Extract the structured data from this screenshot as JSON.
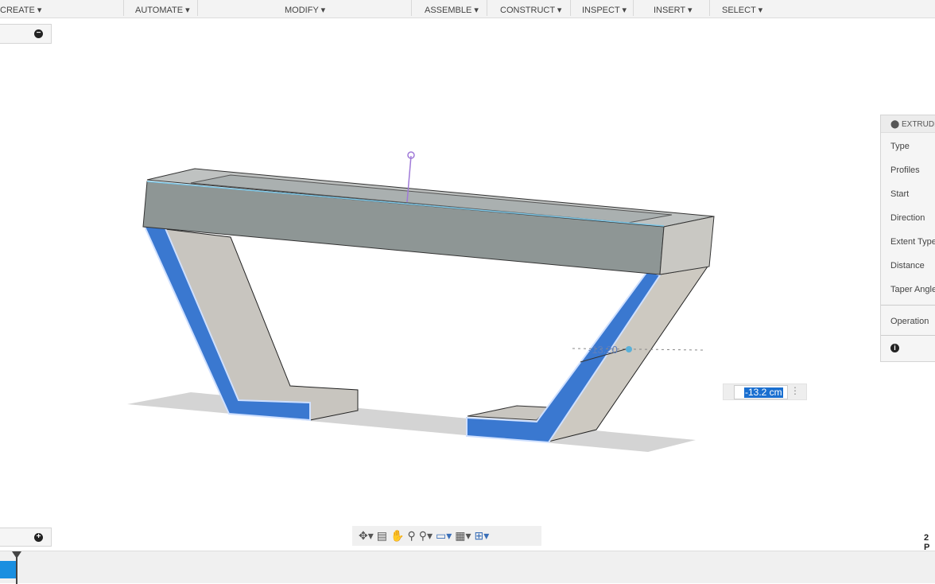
{
  "toolbar": {
    "menus": [
      "CREATE ▾",
      "AUTOMATE ▾",
      "MODIFY ▾",
      "ASSEMBLE ▾",
      "CONSTRUCT ▾",
      "INSPECT ▾",
      "INSERT ▾",
      "SELECT ▾"
    ]
  },
  "extrude_panel": {
    "title": "EXTRUDE",
    "rows": [
      "Type",
      "Profiles",
      "Start",
      "Direction",
      "Extent Type",
      "Distance",
      "Taper Angle",
      "Operation"
    ]
  },
  "viewport": {
    "dimension_label": "-13.20",
    "distance_value": "-13.2 cm",
    "accent": "#3a78d0"
  },
  "nav_bar": {
    "icons": [
      "orbit-icon",
      "look-at-icon",
      "pan-icon",
      "zoom-icon",
      "fit-icon",
      "display-settings-icon",
      "grid-icon",
      "viewports-icon"
    ]
  },
  "status": {
    "corner_text": "2 P"
  }
}
